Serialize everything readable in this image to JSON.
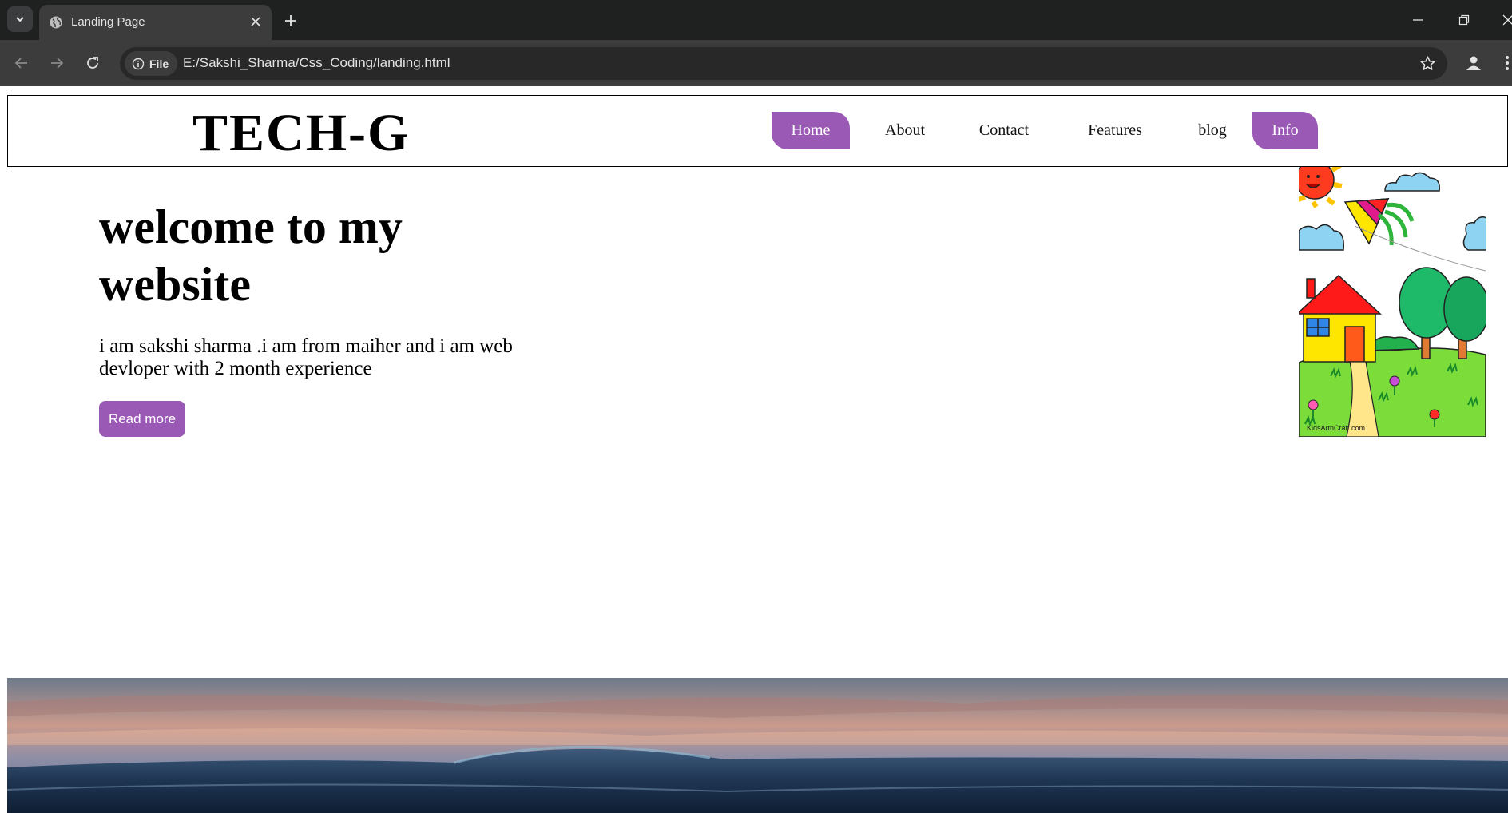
{
  "browser": {
    "tab_title": "Landing Page",
    "address_chip": "File",
    "url": "E:/Sakshi_Sharma/Css_Coding/landing.html",
    "icons": [
      "tab-search-icon",
      "globe-icon",
      "close-icon",
      "plus-icon",
      "minimize-icon",
      "restore-icon",
      "window-close-icon",
      "back-arrow-icon",
      "forward-arrow-icon",
      "reload-icon",
      "info-icon",
      "star-icon",
      "profile-icon",
      "menu-dots-icon"
    ]
  },
  "site": {
    "logo": "TECH-G",
    "nav": [
      {
        "label": "Home"
      },
      {
        "label": "About"
      },
      {
        "label": "Contact"
      },
      {
        "label": "Features"
      },
      {
        "label": "blog"
      },
      {
        "label": "Info"
      }
    ],
    "hero": {
      "title": "welcome to my website",
      "text": "i am sakshi sharma .i am from maiher and i am web devloper with 2 month experience",
      "button": "Read more"
    },
    "image_caption": "KidsArtnCraft.com"
  },
  "colors": {
    "accent": "#9b59b6",
    "chrome_dark": "#1f2020",
    "chrome_toolbar": "#3c3c3c"
  }
}
